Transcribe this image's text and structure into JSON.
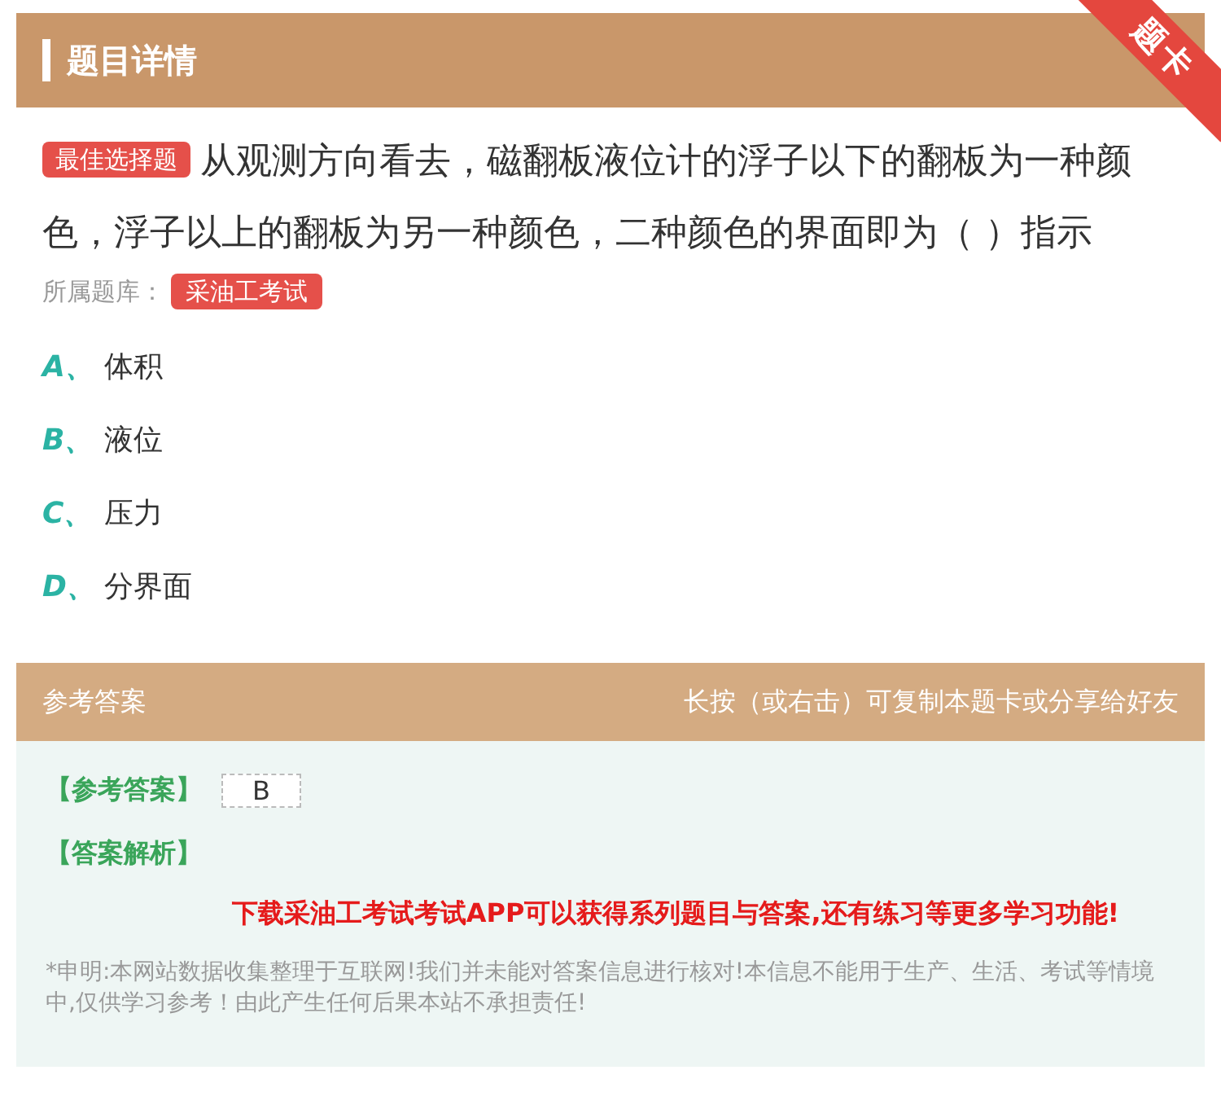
{
  "header": {
    "title": "题目详情",
    "ribbon": "题卡"
  },
  "question": {
    "type_tag": "最佳选择题",
    "text": "从观测方向看去，磁翻板液位计的浮子以下的翻板为一种颜色，浮子以上的翻板为另一种颜色，二种颜色的界面即为（ ）指示",
    "bank_label": "所属题库：",
    "bank_tag": "采油工考试"
  },
  "options": [
    {
      "letter": "A、",
      "text": "体积"
    },
    {
      "letter": "B、",
      "text": "液位"
    },
    {
      "letter": "C、",
      "text": "压力"
    },
    {
      "letter": "D、",
      "text": "分界面"
    }
  ],
  "answer_bar": {
    "title": "参考答案",
    "hint": "长按（或右击）可复制本题卡或分享给好友"
  },
  "answer": {
    "answer_label": "【参考答案】",
    "answer_value": "B",
    "analysis_label": "【答案解析】",
    "promo": "下载采油工考试考试APP可以获得系列题目与答案,还有练习等更多学习功能!",
    "disclaimer": "*申明:本网站数据收集整理于互联网!我们并未能对答案信息进行核对!本信息不能用于生产、生活、考试等情境中,仅供学习参考！由此产生任何后果本站不承担责任!"
  }
}
